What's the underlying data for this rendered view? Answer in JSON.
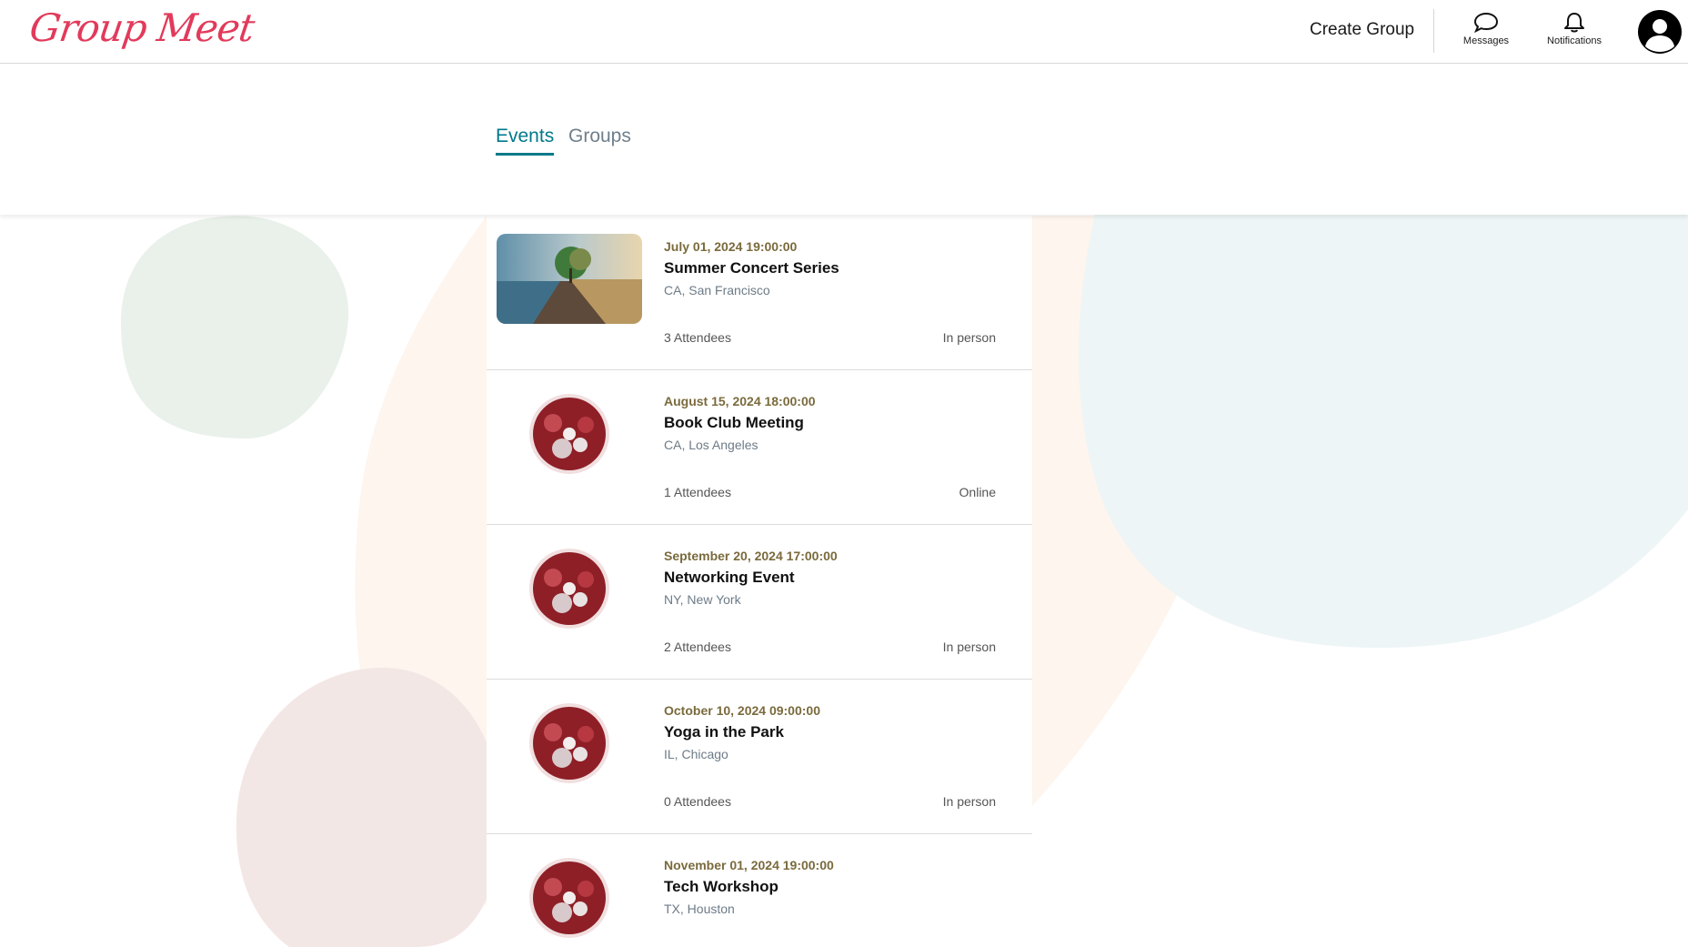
{
  "header": {
    "logo_text": "Group Meet",
    "create_group_label": "Create Group",
    "messages_label": "Messages",
    "notifications_label": "Notifications",
    "icons": {
      "messages": "chat-bubble-icon",
      "notifications": "bell-icon",
      "avatar": "user-avatar-icon"
    }
  },
  "tabs": [
    {
      "label": "Events",
      "active": true
    },
    {
      "label": "Groups",
      "active": false
    }
  ],
  "events": [
    {
      "date": "July 01, 2024 19:00:00",
      "title": "Summer Concert Series",
      "location": "CA, San Francisco",
      "attendees": "3 Attendees",
      "mode": "In person",
      "image": "landscape-photo"
    },
    {
      "date": "August 15, 2024 18:00:00",
      "title": "Book Club Meeting",
      "location": "CA, Los Angeles",
      "attendees": "1 Attendees",
      "mode": "Online",
      "image": "flower-sphere"
    },
    {
      "date": "September 20, 2024 17:00:00",
      "title": "Networking Event",
      "location": "NY, New York",
      "attendees": "2 Attendees",
      "mode": "In person",
      "image": "flower-sphere"
    },
    {
      "date": "October 10, 2024 09:00:00",
      "title": "Yoga in the Park",
      "location": "IL, Chicago",
      "attendees": "0 Attendees",
      "mode": "In person",
      "image": "flower-sphere"
    },
    {
      "date": "November 01, 2024 19:00:00",
      "title": "Tech Workshop",
      "location": "TX, Houston",
      "attendees": "",
      "mode": "",
      "image": "flower-sphere"
    }
  ],
  "colors": {
    "brand": "#e23a5b",
    "accent": "#00798a",
    "date": "#7a6a3c"
  }
}
